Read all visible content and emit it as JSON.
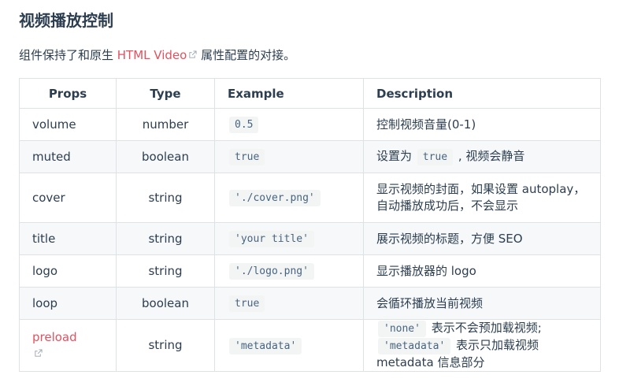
{
  "heading": "视频播放控制",
  "intro": {
    "before": "组件保持了和原生 ",
    "link": "HTML Video",
    "after": " 属性配置的对接。"
  },
  "table": {
    "headers": [
      "Props",
      "Type",
      "Example",
      "Description"
    ],
    "rows": [
      {
        "prop": "volume",
        "type": "number",
        "example": "0.5",
        "desc": "控制视频音量(0-1)"
      },
      {
        "prop": "muted",
        "type": "boolean",
        "example": "true",
        "desc_before": "设置为 ",
        "desc_code": "true",
        "desc_after": " , 视频会静音"
      },
      {
        "prop": "cover",
        "type": "string",
        "example": "'./cover.png'",
        "desc": "显示视频的封面，如果设置 autoplay，自动播放成功后，不会显示"
      },
      {
        "prop": "title",
        "type": "string",
        "example": "'your title'",
        "desc": "展示视频的标题，方便 SEO"
      },
      {
        "prop": "logo",
        "type": "string",
        "example": "'./logo.png'",
        "desc": "显示播放器的 logo"
      },
      {
        "prop": "loop",
        "type": "boolean",
        "example": "true",
        "desc": "会循环播放当前视频"
      },
      {
        "prop": "preload",
        "type": "string",
        "example": "'metadata'",
        "desc_code1": "'none'",
        "desc_mid": " 表示不会预加载视频; ",
        "desc_code2": "'metadata'",
        "desc_after": " 表示只加载视频 metadata 信息部分"
      }
    ]
  },
  "colors": {
    "link": "#e3515f",
    "text": "#2c3e50",
    "code_bg": "#f3f4f4",
    "stripe": "#f6f8fa"
  },
  "icons": [
    "external-link-icon"
  ]
}
